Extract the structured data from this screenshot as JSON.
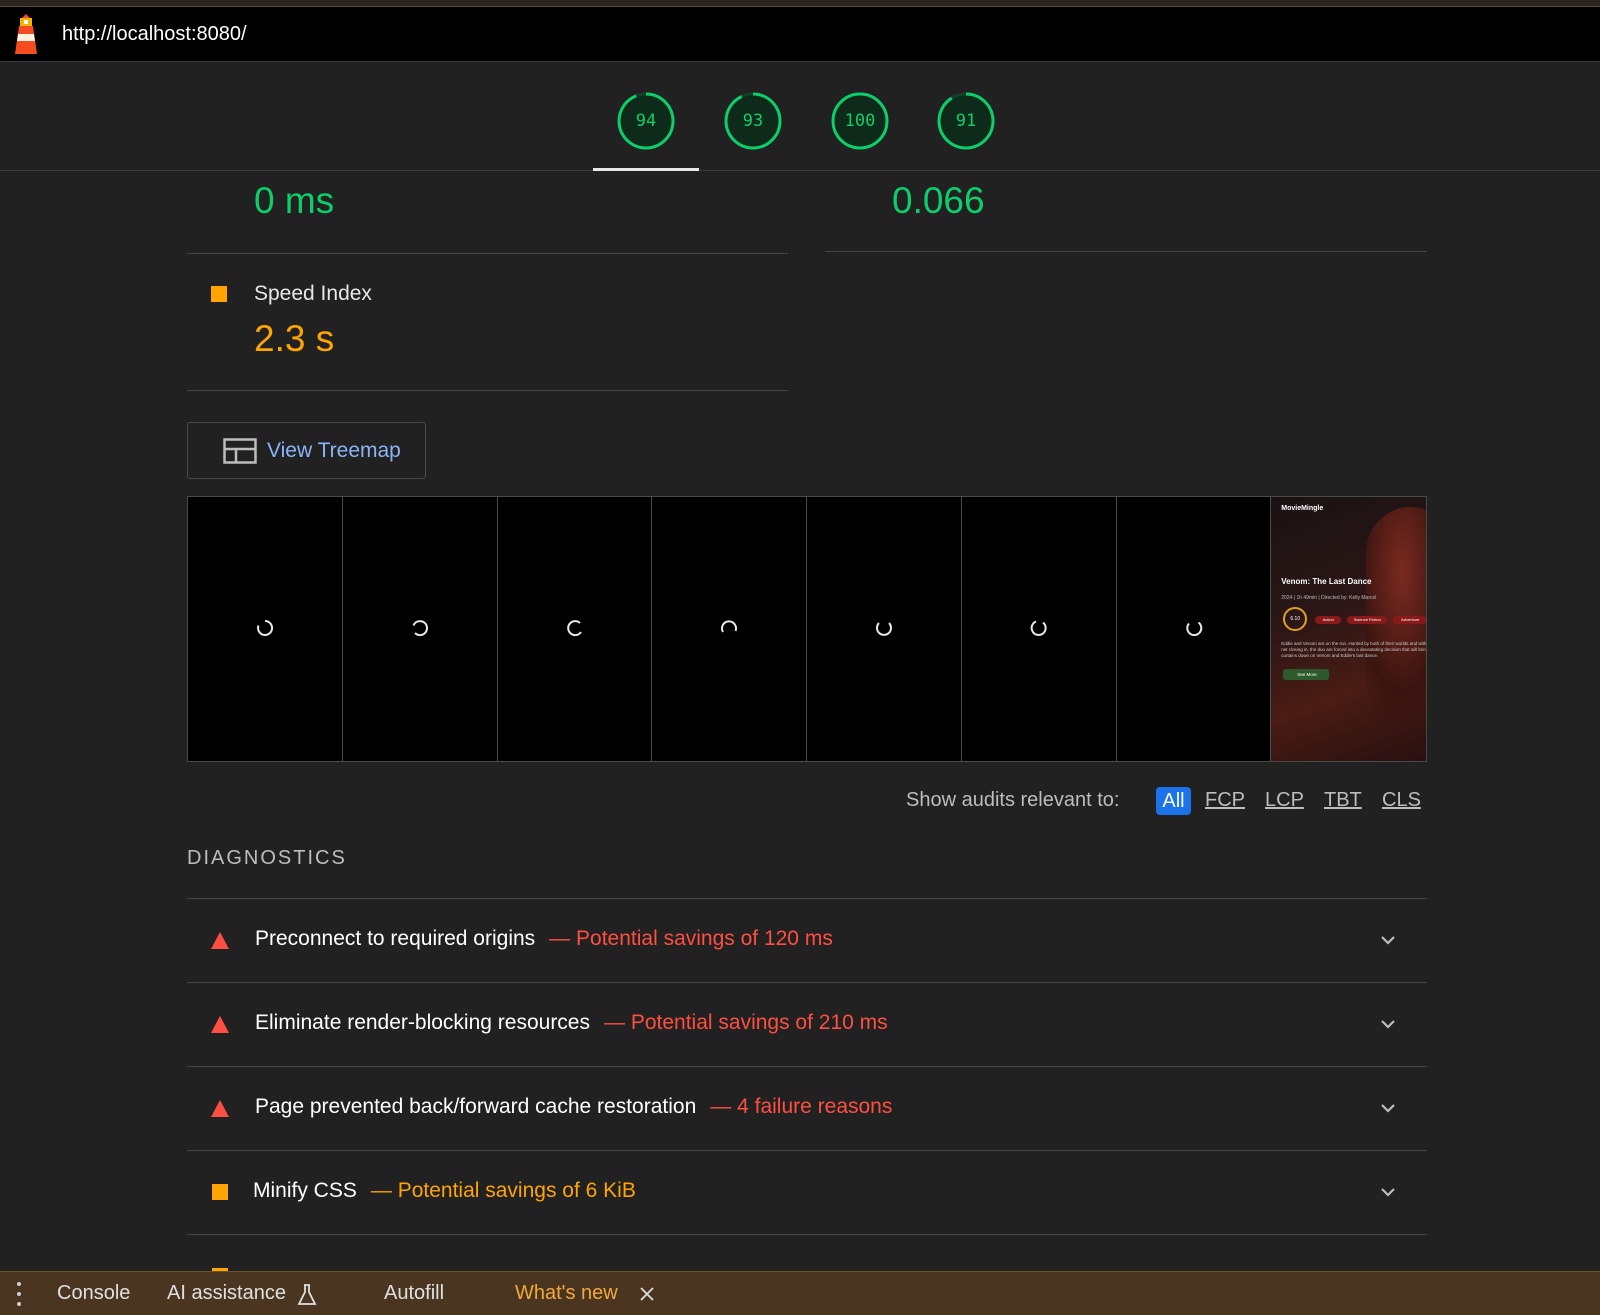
{
  "url": "http://localhost:8080/",
  "gauges": [
    {
      "score": "94",
      "value": 94
    },
    {
      "score": "93",
      "value": 93
    },
    {
      "score": "100",
      "value": 100
    },
    {
      "score": "91",
      "value": 91
    }
  ],
  "colors": {
    "pass": "#0cce6b",
    "average": "#ffa400",
    "fail": "#ff4e42",
    "accent": "#1a73e8"
  },
  "metrics": {
    "tbt_value": "0 ms",
    "cls_value": "0.066",
    "speed_index": {
      "title": "Speed Index",
      "value": "2.3 s"
    }
  },
  "treemap": {
    "label": "View Treemap"
  },
  "filmstrip": {
    "final_frame": {
      "brand": "MovieMingle",
      "title": "Venom: The Last Dance",
      "meta": "2024 | 1h 49min | Directed by: Kelly Marcel",
      "rating": "6.10",
      "tags": [
        "Action",
        "Science Fiction",
        "Adventure"
      ],
      "description": "Eddie and Venom are on the run. Hunted by both of their worlds and with the net closing in, the duo are forced into a devastating decision that will bring the curtains down on Venom and Eddie's last dance.",
      "button": "See More"
    }
  },
  "filter": {
    "label": "Show audits relevant to:",
    "options": [
      "All",
      "FCP",
      "LCP",
      "TBT",
      "CLS"
    ]
  },
  "diagnostics": {
    "heading": "DIAGNOSTICS",
    "audits": [
      {
        "title": "Preconnect to required origins",
        "savings": "— Potential savings of 120 ms",
        "severity": "fail"
      },
      {
        "title": "Eliminate render-blocking resources",
        "savings": "— Potential savings of 210 ms",
        "severity": "fail"
      },
      {
        "title": "Page prevented back/forward cache restoration",
        "savings": "— 4 failure reasons",
        "severity": "fail"
      },
      {
        "title": "Minify CSS",
        "savings": "— Potential savings of 6 KiB",
        "severity": "average"
      }
    ]
  },
  "bottom_bar": {
    "tabs": [
      "Console",
      "AI assistance",
      "Autofill",
      "What's new"
    ]
  }
}
